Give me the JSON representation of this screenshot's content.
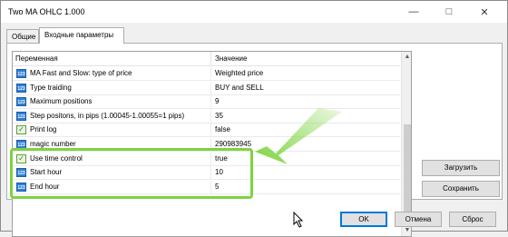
{
  "window": {
    "title": "Two MA OHLC 1.000",
    "minimize_icon": "minimize-icon",
    "maximize_icon": "maximize-icon",
    "close_icon": "close-icon"
  },
  "tabs": [
    {
      "label": "Общие",
      "active": false
    },
    {
      "label": "Входные параметры",
      "active": true
    }
  ],
  "grid": {
    "col_variable": "Переменная",
    "col_value": "Значение",
    "rows": [
      {
        "icon": "number-param-icon",
        "name": "MA Fast and Slow: type of price",
        "value": "Weighted price"
      },
      {
        "icon": "number-param-icon",
        "name": "Type traiding",
        "value": "BUY and SELL"
      },
      {
        "icon": "number-param-icon",
        "name": "Maximum positions",
        "value": "9"
      },
      {
        "icon": "number-param-icon",
        "name": "Step positons, in pips (1.00045-1.00055=1 pips)",
        "value": "35"
      },
      {
        "icon": "bool-param-icon",
        "name": "Print log",
        "value": "false"
      },
      {
        "icon": "number-param-icon",
        "name": "magic number",
        "value": "290983945"
      },
      {
        "icon": "bool-param-icon",
        "name": "Use time control",
        "value": "true"
      },
      {
        "icon": "number-param-icon",
        "name": "Start hour",
        "value": "10"
      },
      {
        "icon": "number-param-icon",
        "name": "End hour",
        "value": "5"
      }
    ],
    "icon_text": "123"
  },
  "side_buttons": {
    "load": "Загрузить",
    "save": "Сохранить"
  },
  "footer_buttons": {
    "ok": "OK",
    "cancel": "Отмена",
    "reset": "Сброс"
  },
  "colors": {
    "highlight": "#7ed340",
    "accent": "#0078d7"
  }
}
